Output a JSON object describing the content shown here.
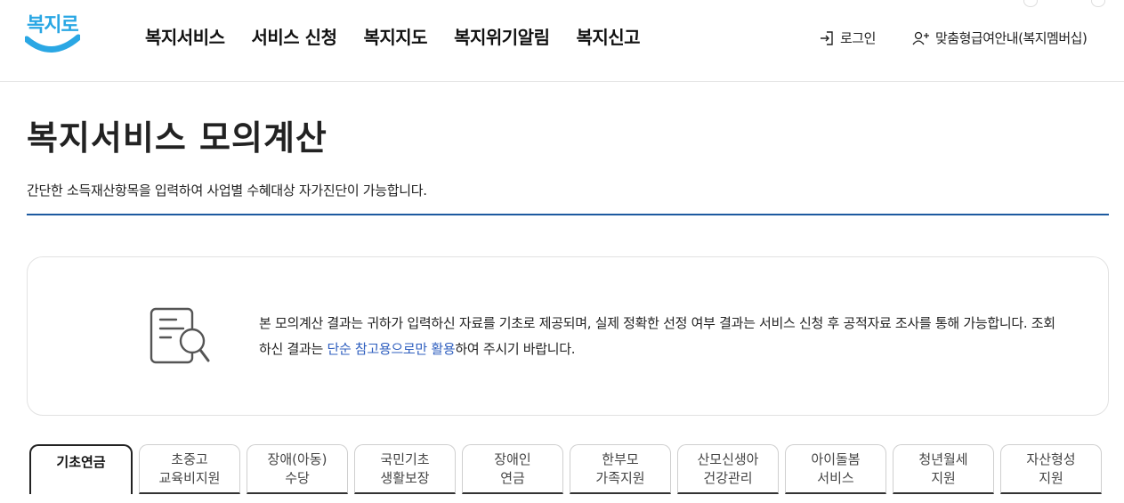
{
  "header": {
    "logo_text": "복지로",
    "nav": [
      "복지서비스",
      "서비스 신청",
      "복지지도",
      "복지위기알림",
      "복지신고"
    ],
    "login_label": "로그인",
    "member_label": "맞춤형급여안내(복지멤버십)"
  },
  "page": {
    "title": "복지서비스 모의계산",
    "description": "간단한 소득재산항목을 입력하여 사업별 수혜대상 자가진단이 가능합니다."
  },
  "notice": {
    "text_before": "본 모의계산 결과는 귀하가 입력하신 자료를 기초로 제공되며, 실제 정확한 선정 여부 결과는 서비스 신청 후 공적자료 조사를 통해 가능합니다. 조회하신 결과는 ",
    "text_highlight": "단순 참고용으로만 활용",
    "text_after": "하여 주시기 바랍니다."
  },
  "tabs": [
    {
      "line1": "기초연금",
      "line2": "",
      "active": true
    },
    {
      "line1": "초중고",
      "line2": "교육비지원",
      "active": false
    },
    {
      "line1": "장애(아동)",
      "line2": "수당",
      "active": false
    },
    {
      "line1": "국민기초",
      "line2": "생활보장",
      "active": false
    },
    {
      "line1": "장애인",
      "line2": "연금",
      "active": false
    },
    {
      "line1": "한부모",
      "line2": "가족지원",
      "active": false
    },
    {
      "line1": "산모신생아",
      "line2": "건강관리",
      "active": false
    },
    {
      "line1": "아이돌봄",
      "line2": "서비스",
      "active": false
    },
    {
      "line1": "청년월세",
      "line2": "지원",
      "active": false
    },
    {
      "line1": "자산형성",
      "line2": "지원",
      "active": false
    }
  ],
  "colors": {
    "brand": "#2aa7e4",
    "title_underline": "#1d5aa0",
    "highlight_text": "#2f5fbf"
  }
}
